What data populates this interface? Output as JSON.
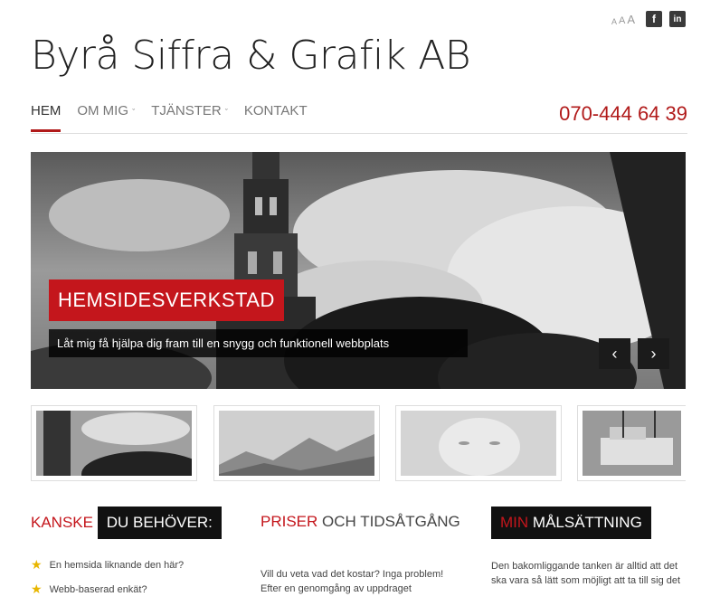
{
  "header": {
    "logo_text": "Byrå Siffra & Grafik AB",
    "font_size_labels": [
      "A",
      "A",
      "A"
    ],
    "social": [
      {
        "icon": "facebook-icon",
        "label": "f"
      },
      {
        "icon": "linkedin-icon",
        "label": "in"
      }
    ],
    "phone": "070-444 64 39"
  },
  "nav": {
    "items": [
      {
        "label": "HEM",
        "active": true
      },
      {
        "label": "OM MIG",
        "dropdown": true
      },
      {
        "label": "TJÄNSTER",
        "dropdown": true
      },
      {
        "label": "KONTAKT"
      }
    ],
    "accent_color": "#b11a1a"
  },
  "slider": {
    "title": "HEMSIDESVERKSTAD",
    "subtitle": "Låt mig få hjälpa dig fram till en snygg och funktionell webbplats",
    "prev": "‹",
    "next": "›"
  },
  "columns": {
    "col1": {
      "heading_red": "KANSKE",
      "heading_box": "DU BEHÖVER:",
      "items": [
        "En hemsida liknande den här?",
        "Webb-baserad enkät?"
      ]
    },
    "col2": {
      "heading_red": "PRISER",
      "heading_rest": " OCH TIDSÅTGÅNG",
      "text1": "Vill du veta vad det kostar? Inga problem!",
      "text2": "Efter en genomgång av uppdraget"
    },
    "col3": {
      "heading_red": "MIN",
      "heading_box": "MÅLSÄTTNING",
      "text1": "Den bakomliggande tanken är alltid att det",
      "text2": "ska vara så lätt som möjligt att ta till sig det"
    }
  }
}
